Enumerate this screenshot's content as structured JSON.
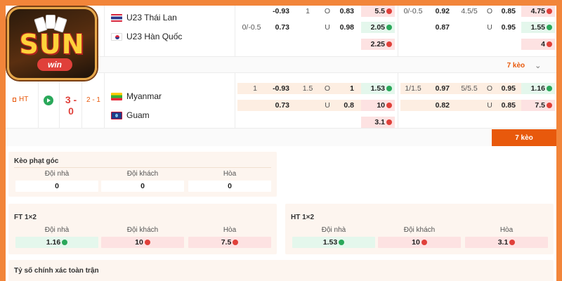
{
  "logo": {
    "text": "SUN",
    "sub": "win"
  },
  "match1": {
    "home_team": "U23 Thái Lan",
    "away_team": "U23 Hàn Quốc",
    "row1": {
      "hcp": "",
      "hcp_odds": "-0.93",
      "ou_line": "1",
      "ou_side": "O",
      "ou_odds": "0.83",
      "x12": "5.5",
      "ht_hcp": "0/-0.5",
      "ht_hcp_odds": "0.92",
      "ht_ou_line": "4.5/5",
      "ht_ou_side": "O",
      "ht_ou_odds": "0.85",
      "ht_x12": "4.75"
    },
    "row2": {
      "hcp": "0/-0.5",
      "hcp_odds": "0.73",
      "ou_side": "U",
      "ou_odds": "0.98",
      "x12": "2.05",
      "ht_hcp_odds": "0.87",
      "ht_ou_side": "U",
      "ht_ou_odds": "0.95",
      "ht_x12": "1.55"
    },
    "row3": {
      "x12": "2.25",
      "ht_x12": "4"
    },
    "more_label": "7 kèo",
    "chevron": "chevron-down-icon"
  },
  "match2": {
    "status": "HT",
    "score": "3 - 0",
    "ht_score": "2 - 1",
    "home_team": "Myanmar",
    "away_team": "Guam",
    "row1": {
      "hcp": "1",
      "hcp_odds": "-0.93",
      "ou_line": "1.5",
      "ou_side": "O",
      "ou_odds": "1",
      "x12": "1.53",
      "ht_hcp": "1/1.5",
      "ht_hcp_odds": "0.97",
      "ht_ou_line": "5/5.5",
      "ht_ou_side": "O",
      "ht_ou_odds": "0.95",
      "ht_x12": "1.16"
    },
    "row2": {
      "hcp_odds": "0.73",
      "ou_side": "U",
      "ou_odds": "0.8",
      "x12": "10",
      "ht_hcp_odds": "0.82",
      "ht_ou_side": "U",
      "ht_ou_odds": "0.85",
      "ht_x12": "7.5"
    },
    "row3": {
      "x12": "3.1"
    },
    "more_label": "7 kèo"
  },
  "corner": {
    "title": "Kèo phạt góc",
    "cols": [
      "Đội nhà",
      "Đội khách",
      "Hòa"
    ],
    "values": [
      "0",
      "0",
      "0"
    ]
  },
  "ft": {
    "title": "FT 1×2",
    "cols": [
      "Đội nhà",
      "Đội khách",
      "Hòa"
    ],
    "values": [
      "1.16",
      "10",
      "7.5"
    ]
  },
  "ht": {
    "title": "HT 1×2",
    "cols": [
      "Đội nhà",
      "Đội khách",
      "Hòa"
    ],
    "values": [
      "1.53",
      "10",
      "3.1"
    ]
  },
  "exact": {
    "title": "Tỷ số chính xác toàn trận"
  },
  "colors": {
    "orange": "#e8590c",
    "frame": "#f2853a"
  }
}
